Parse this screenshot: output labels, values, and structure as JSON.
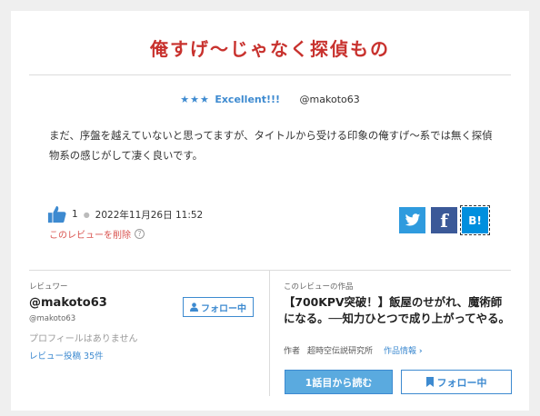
{
  "review": {
    "title": "俺すげ〜じゃなく探偵もの",
    "stars": "★★★",
    "rating_label": "Excellent!!!",
    "reviewer_handle": "@makoto63",
    "body": "まだ、序盤を越えていないと思ってますが、タイトルから受ける印象の俺すげ〜系では無く探偵物系の感じがして凄く良いです。",
    "like_count": "1",
    "date": "2022年11月26日 11:52",
    "delete_label": "このレビューを削除",
    "help_glyph": "?",
    "share": {
      "twitter_icon": "twitter-icon",
      "facebook_glyph": "f",
      "hatena_label": "B!"
    }
  },
  "reviewer": {
    "section_label": "レビュワー",
    "name": "@makoto63",
    "handle": "@makoto63",
    "profile": "プロフィールはありません",
    "posts": "レビュー投稿 35件",
    "follow_label": "フォロー中"
  },
  "work": {
    "section_label": "このレビューの作品",
    "title": "【700KPV突破！】飯屋のせがれ、魔術師になる。──知力ひとつで成り上がってやる。",
    "author_label": "作者",
    "author": "超時空伝説研究所",
    "info_label": "作品情報",
    "read_label": "1話目から読む",
    "follow_label": "フォロー中"
  },
  "colors": {
    "title_red": "#c8322e",
    "accent_blue": "#3d8ad0",
    "twitter": "#2f9bde",
    "facebook": "#3b5998",
    "hatena": "#008fde"
  }
}
